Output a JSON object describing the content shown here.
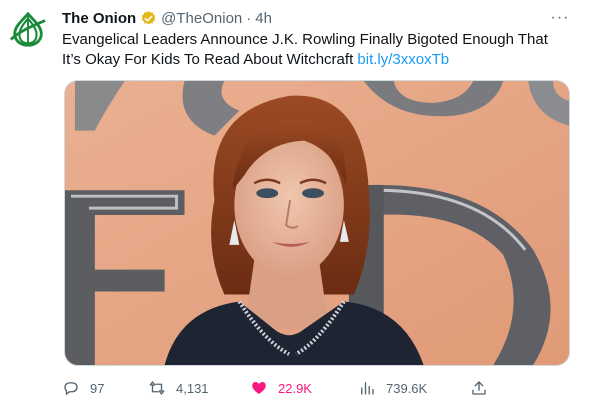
{
  "account": {
    "name": "The Onion",
    "handle": "@TheOnion",
    "separator": "·",
    "time": "4h",
    "avatar_icon": "onion-logo-icon",
    "verified_icon": "verified-gold-badge-icon",
    "brand_color": "#1a8a3b"
  },
  "tweet": {
    "text": "Evangelical Leaders Announce J.K. Rowling Finally Bigoted Enough That It’s Okay For Kids To Read About Witchcraft",
    "link": "bit.ly/3xxoxTb",
    "link_color": "#1d9bf0"
  },
  "menu": {
    "more_icon": "more-horizontal-icon",
    "more_label": "···"
  },
  "actions": {
    "replies": "97",
    "retweets": "4,131",
    "likes": "22.9K",
    "views": "739.6K",
    "like_color": "#f91880"
  }
}
